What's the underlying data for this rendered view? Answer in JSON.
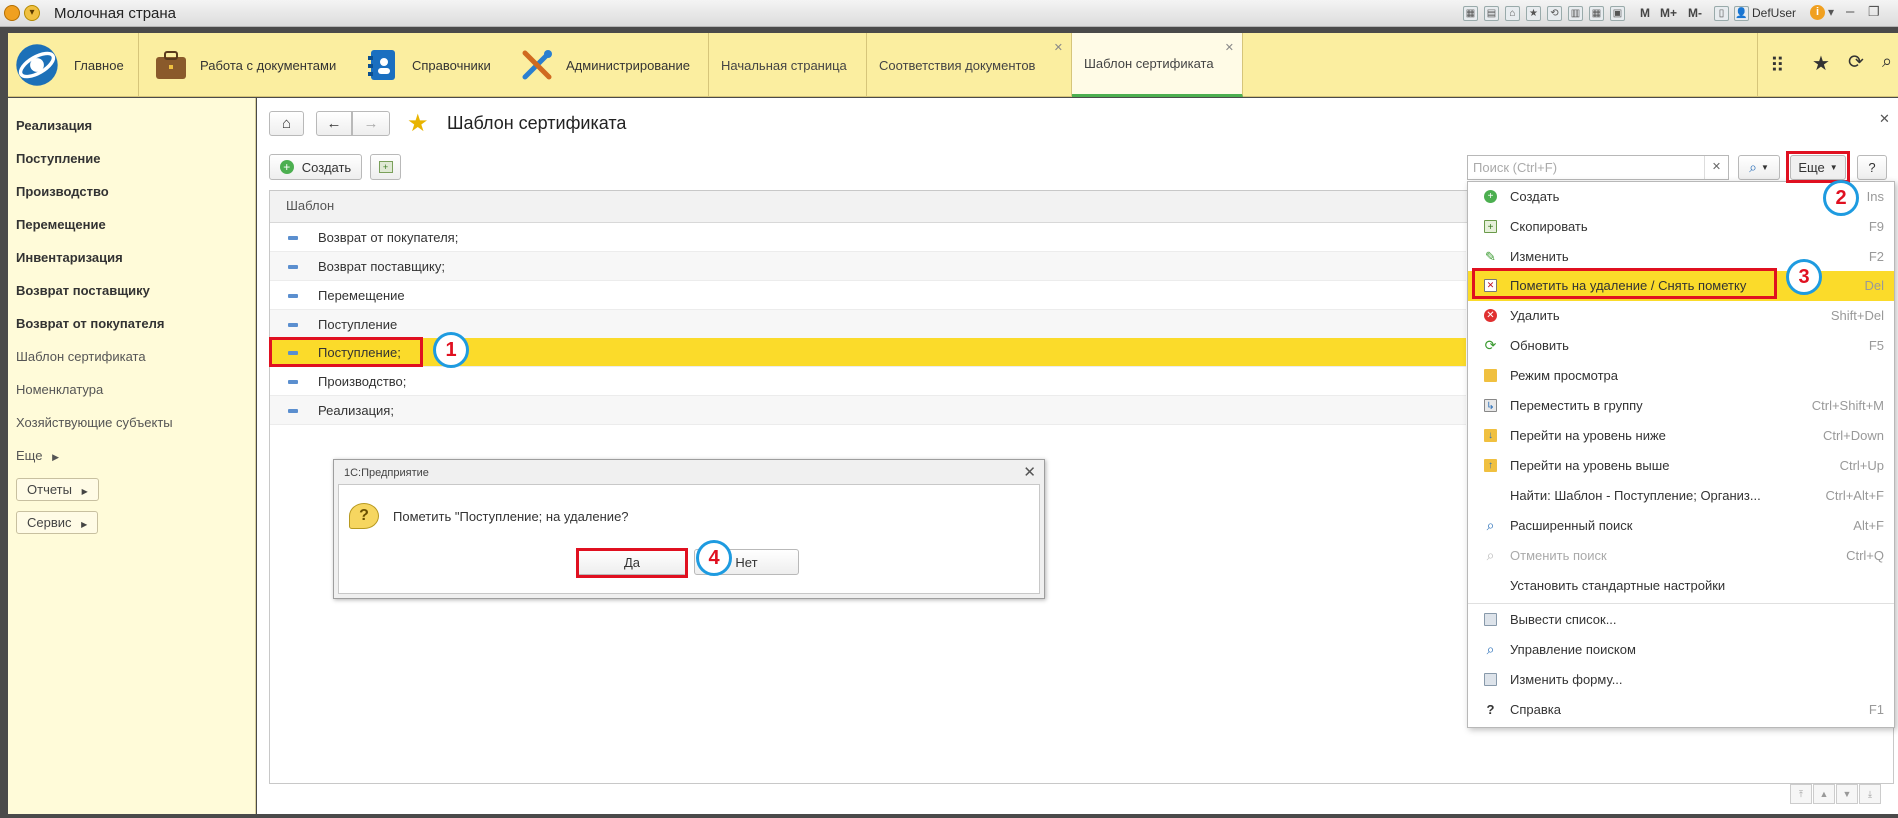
{
  "window": {
    "title": "Молочная страна",
    "toolbar_texts": [
      "M",
      "M+",
      "M-"
    ],
    "user": "DefUser"
  },
  "sections": [
    {
      "label": "Главное",
      "icon": "1c-logo-icon"
    },
    {
      "label": "Работа с документами",
      "icon": "briefcase-icon"
    },
    {
      "label": "Справочники",
      "icon": "address-book-icon"
    },
    {
      "label": "Администрирование",
      "icon": "tools-icon"
    }
  ],
  "open_tabs": [
    {
      "label": "Начальная страница",
      "closable": false
    },
    {
      "label": "Соответствия документов",
      "closable": true
    },
    {
      "label": "Шаблон сертификата",
      "closable": true,
      "active": true
    }
  ],
  "left_nav": {
    "bold_items": [
      "Реализация",
      "Поступление",
      "Производство",
      "Перемещение",
      "Инвентаризация",
      "Возврат поставщику",
      "Возврат от покупателя"
    ],
    "normal_items": [
      "Шаблон сертификата",
      "Номенклатура",
      "Хозяйствующие субъекты"
    ],
    "more_label": "Еще",
    "buttons": [
      "Отчеты",
      "Сервис"
    ]
  },
  "form": {
    "title": "Шаблон сертификата",
    "create_label": "Создать",
    "search_placeholder": "Поиск (Ctrl+F)",
    "more_label": "Еще",
    "help_label": "?",
    "column_header": "Шаблон",
    "rows": [
      "Возврат от покупателя;",
      "Возврат поставщику;",
      "Перемещение",
      "Поступление",
      "Поступление;",
      "Производство;",
      "Реализация;"
    ],
    "selected_row": 4
  },
  "menu": {
    "items": [
      {
        "label": "Создать",
        "key": "Ins",
        "icon": "create-icon"
      },
      {
        "label": "Скопировать",
        "key": "F9",
        "icon": "copy-icon"
      },
      {
        "label": "Изменить",
        "key": "F2",
        "icon": "edit-icon"
      },
      {
        "label": "Пометить на удаление / Снять пометку",
        "key": "Del",
        "icon": "mark-delete-icon",
        "highlight": true
      },
      {
        "label": "Удалить",
        "key": "Shift+Del",
        "icon": "delete-icon"
      },
      {
        "label": "Обновить",
        "key": "F5",
        "icon": "refresh-icon"
      },
      {
        "label": "Режим просмотра",
        "key": "",
        "icon": "view-mode-icon"
      },
      {
        "label": "Переместить в группу",
        "key": "Ctrl+Shift+M",
        "icon": "move-group-icon"
      },
      {
        "label": "Перейти на уровень ниже",
        "key": "Ctrl+Down",
        "icon": "level-down-icon"
      },
      {
        "label": "Перейти на уровень выше",
        "key": "Ctrl+Up",
        "icon": "level-up-icon"
      },
      {
        "label": "Найти: Шаблон - Поступление; Организ...",
        "key": "Ctrl+Alt+F",
        "icon": ""
      },
      {
        "label": "Расширенный поиск",
        "key": "Alt+F",
        "icon": "search-icon"
      },
      {
        "label": "Отменить поиск",
        "key": "Ctrl+Q",
        "icon": "cancel-search-icon",
        "disabled": true
      },
      {
        "label": "Установить стандартные настройки",
        "key": "",
        "icon": ""
      },
      {
        "label": "Вывести список...",
        "key": "",
        "icon": "print-list-icon"
      },
      {
        "label": "Управление поиском",
        "key": "",
        "icon": "search-manage-icon"
      },
      {
        "label": "Изменить форму...",
        "key": "",
        "icon": "form-edit-icon"
      },
      {
        "label": "Справка",
        "key": "F1",
        "icon": "help-icon"
      }
    ]
  },
  "dialog": {
    "title": "1С:Предприятие",
    "message": "Пометить \"Поступление;   на удаление?",
    "yes_label": "Да",
    "no_label": "Нет"
  },
  "annotations": [
    "1",
    "2",
    "3",
    "4"
  ],
  "colors": {
    "section_bar": "#fbeea0",
    "left_panel": "#fffbd9",
    "selection": "#fbdb2a",
    "annotation_red": "#e01020",
    "annotation_blue": "#1e9be0"
  }
}
